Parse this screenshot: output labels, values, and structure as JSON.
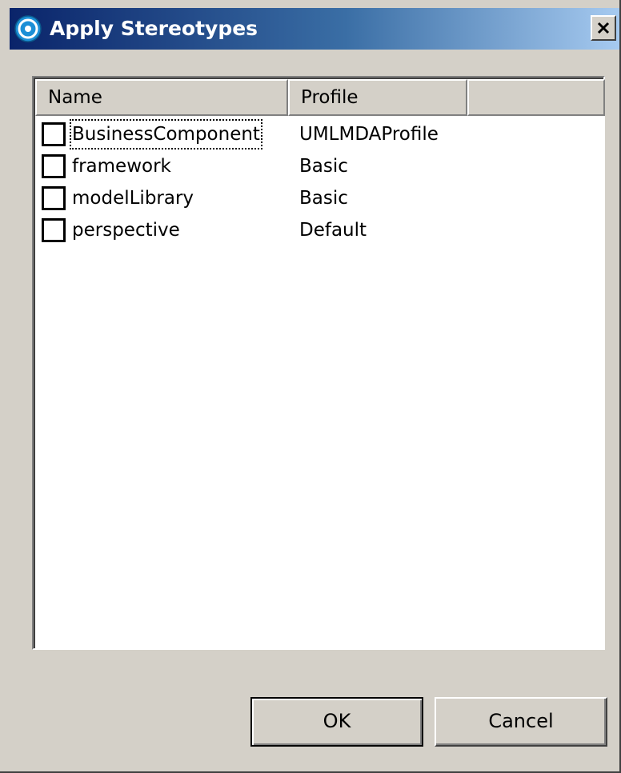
{
  "window": {
    "title": "Apply Stereotypes",
    "icon": "swirl-app-icon",
    "close_icon": "close-icon"
  },
  "table": {
    "columns": [
      "Name",
      "Profile",
      ""
    ],
    "rows": [
      {
        "name": "BusinessComponent",
        "profile": "UMLMDAProfile",
        "checked": false,
        "focused": true
      },
      {
        "name": "framework",
        "profile": "Basic",
        "checked": false,
        "focused": false
      },
      {
        "name": "modelLibrary",
        "profile": "Basic",
        "checked": false,
        "focused": false
      },
      {
        "name": "perspective",
        "profile": "Default",
        "checked": false,
        "focused": false
      }
    ]
  },
  "buttons": {
    "ok": "OK",
    "cancel": "Cancel"
  },
  "colors": {
    "titlebar_start": "#0a246a",
    "titlebar_end": "#a6caf0",
    "dialog_face": "#d4d0c8"
  }
}
